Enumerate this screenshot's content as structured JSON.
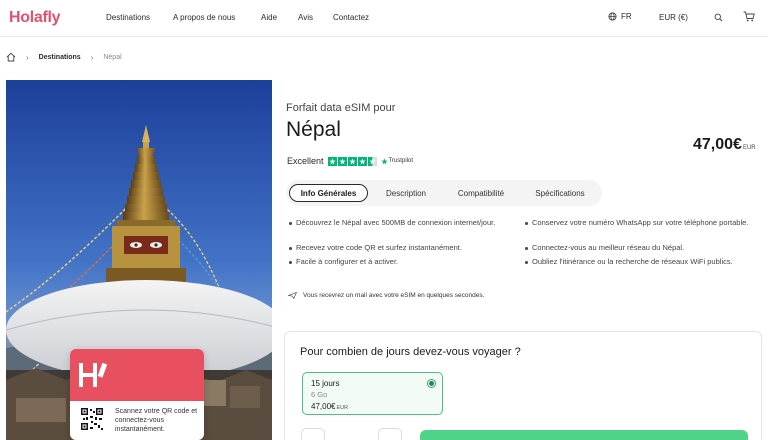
{
  "header": {
    "logo": "Holafly",
    "nav": [
      {
        "label": "Destinations"
      },
      {
        "label": "A propos de nous"
      },
      {
        "label": "Aide"
      },
      {
        "label": "Avis"
      },
      {
        "label": "Contactez"
      }
    ],
    "language": "FR",
    "currency": "EUR (€)"
  },
  "breadcrumb": {
    "items": [
      {
        "label": "Destinations"
      },
      {
        "label": "Népal"
      }
    ]
  },
  "hero": {
    "qr_text": "Scannez votre QR code et connectez-vous instantanément."
  },
  "product": {
    "subtitle": "Forfait data eSIM pour",
    "title": "Népal",
    "price": "47,00€",
    "price_currency": "EUR",
    "rating_label": "Excellent",
    "rating_stars": 4.5,
    "trustpilot": "Trustpilot"
  },
  "tabs": [
    {
      "label": "Info Générales",
      "active": true
    },
    {
      "label": "Description",
      "active": false
    },
    {
      "label": "Compatibilité",
      "active": false
    },
    {
      "label": "Spécifications",
      "active": false
    }
  ],
  "features": {
    "left": [
      "Découvrez le Népal avec 500MB de connexion internet/jour.",
      "Recevez votre code QR et surfez instantanément.",
      "Facile à configurer et à activer."
    ],
    "right": [
      "Conservez votre numéro WhatsApp sur votre téléphone portable.",
      "Connectez-vous au meilleur réseau du Népal.",
      "Oubliez l'itinérance ou la recherche de réseaux WiFi publics."
    ]
  },
  "notice": "Vous recevrez un mail avec votre eSIM en quelques secondes.",
  "duration": {
    "question": "Pour combien de jours devez-vous voyager ?",
    "selected_plan": {
      "days": "15 jours",
      "data": "6 Go",
      "price": "47,00€",
      "currency": "EUR"
    }
  },
  "colors": {
    "brand": "#e5506a",
    "trustpilot_green": "#00b67a",
    "selected_green": "#4fbf84",
    "buy_button": "#4ed489"
  }
}
